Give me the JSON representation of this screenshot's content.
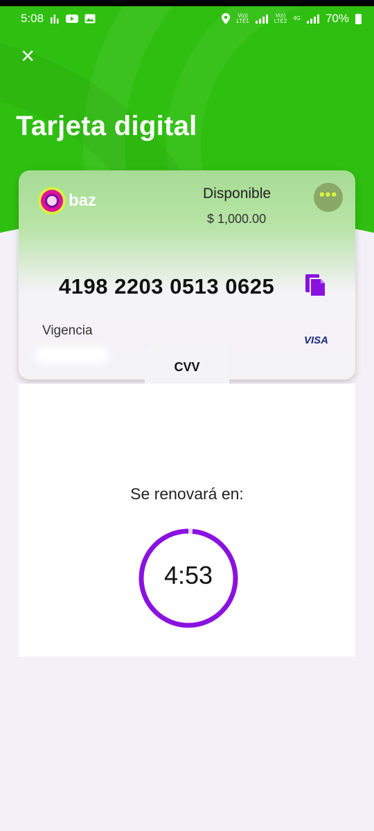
{
  "status_bar": {
    "time": "5:08",
    "sim1_label_top": "Vo))",
    "sim1_label_bottom": "LTE1",
    "sim2_label_top": "Vo))",
    "sim2_label_bottom": "LTE2",
    "network": "4G",
    "battery": "70%"
  },
  "header": {
    "close_symbol": "×",
    "title": "Tarjeta digital"
  },
  "card": {
    "brand": "baz",
    "available_label": "Disponible",
    "available_amount": "$ 1,000.00",
    "more_symbol": "•••",
    "number": "4198 2203 0513 0625",
    "validity_label": "Vigencia",
    "network_logo": "VISA",
    "cvv_label": "CVV"
  },
  "renewal": {
    "label": "Se renovará en:",
    "countdown": "4:53"
  },
  "colors": {
    "brand_green": "#2fbf10",
    "accent_purple": "#8a12e0",
    "card_green": "#a6dc94"
  }
}
